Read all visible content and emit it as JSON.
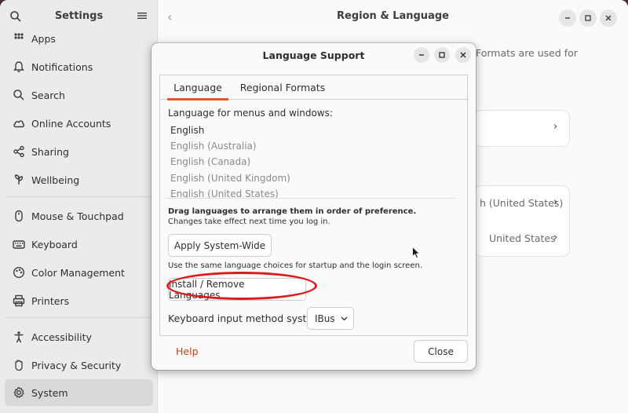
{
  "settings": {
    "title": "Settings",
    "sidebar": [
      {
        "label": "Apps",
        "icon": "apps-icon"
      },
      {
        "label": "Notifications",
        "icon": "bell-icon"
      },
      {
        "label": "Search",
        "icon": "search-icon"
      },
      {
        "label": "Online Accounts",
        "icon": "cloud-icon"
      },
      {
        "label": "Sharing",
        "icon": "share-icon"
      },
      {
        "label": "Wellbeing",
        "icon": "leaf-icon"
      },
      {
        "label": "Mouse & Touchpad",
        "icon": "mouse-icon"
      },
      {
        "label": "Keyboard",
        "icon": "keyboard-icon"
      },
      {
        "label": "Color Management",
        "icon": "palette-icon"
      },
      {
        "label": "Printers",
        "icon": "printer-icon"
      },
      {
        "label": "Accessibility",
        "icon": "accessibility-icon"
      },
      {
        "label": "Privacy & Security",
        "icon": "hand-icon"
      },
      {
        "label": "System",
        "icon": "gear-icon"
      }
    ],
    "active_item": "System"
  },
  "main": {
    "title": "Region & Language",
    "bg_text_formats": "Formats are used for",
    "bg_row1_value": "h (United States)",
    "bg_row2_value": "United States"
  },
  "dialog": {
    "title": "Language Support",
    "tabs": [
      "Language",
      "Regional Formats"
    ],
    "active_tab": "Language",
    "menus_label": "Language for menus and windows:",
    "languages": [
      "English",
      "English (Australia)",
      "English (Canada)",
      "English (United Kingdom)",
      "English (United States)"
    ],
    "drag_hint": "Drag languages to arrange them in order of preference.",
    "drag_subhint": "Changes take effect next time you log in.",
    "apply_button": "Apply System-Wide",
    "apply_hint": "Use the same language choices for startup and the login screen.",
    "install_button": "Install / Remove Languages...",
    "input_method_label": "Keyboard input method system:",
    "input_method_value": "IBus",
    "help_button": "Help",
    "close_button": "Close"
  },
  "colors": {
    "accent": "#e95420",
    "highlight_ellipse": "#dc1c1c",
    "help_link": "#c34113"
  }
}
